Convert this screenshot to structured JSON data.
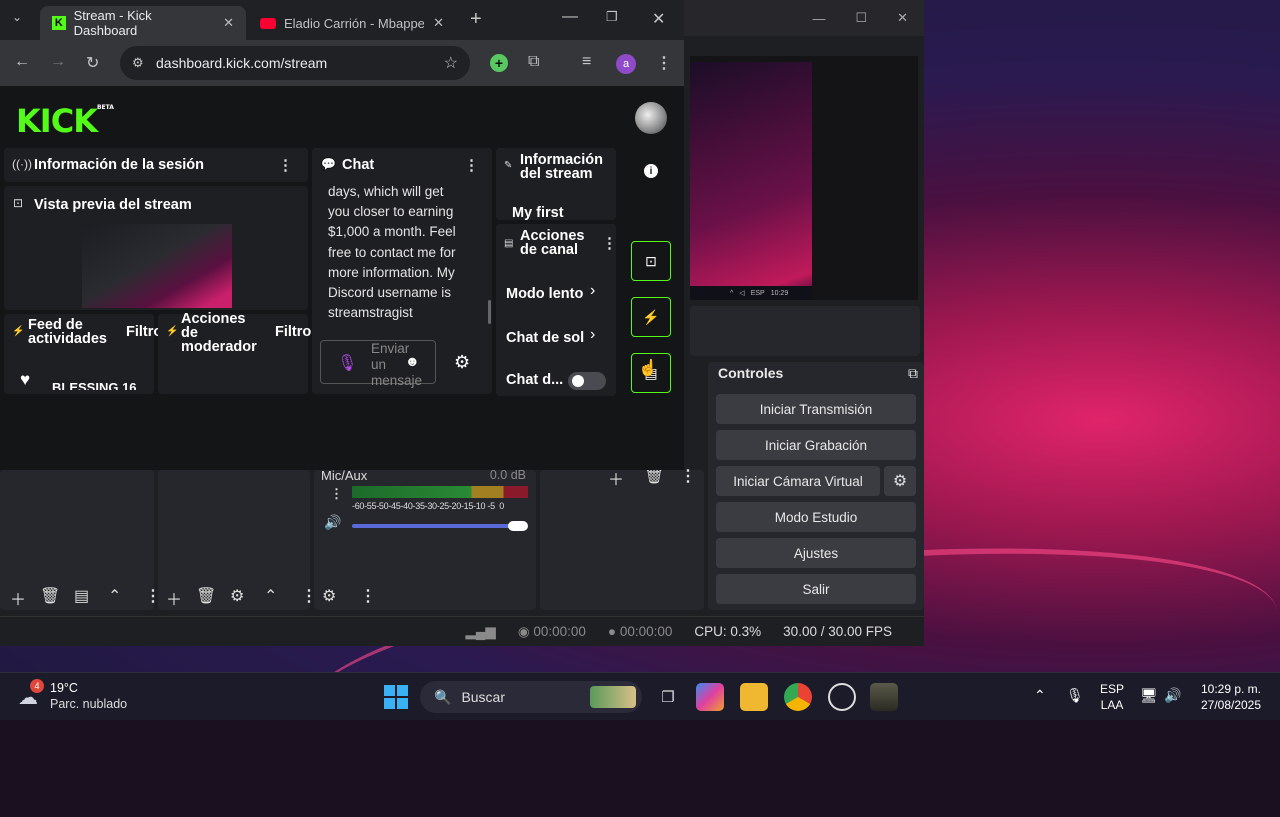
{
  "browser": {
    "tabs": [
      {
        "title": "Stream - Kick Dashboard",
        "active": true
      },
      {
        "title": "Eladio Carrión - Mbappe (",
        "active": false
      }
    ],
    "url": "dashboard.kick.com/stream",
    "profile_initial": "a"
  },
  "kick": {
    "logo": "KICK",
    "logo_badge": "BETA",
    "session_info": "Información de la sesión",
    "stream_preview": "Vista previa del stream",
    "activity_feed": "Feed de actividades",
    "activity_filter": "Filtro",
    "activity_item": "BLESSING 16",
    "mod_actions": "Acciones de moderador",
    "mod_filter": "Filtro",
    "chat_title": "Chat",
    "chat_lines": [
      "days, which will get",
      "you closer to earning",
      "$1,000 a month. Feel",
      "free to contact me for",
      "more information. My",
      "Discord username is",
      "streamstragist"
    ],
    "chat_placeholder": "Enviar un mensaje",
    "stream_info": "Información del stream",
    "stream_info_value": "My first",
    "channel_actions": "Acciones de canal",
    "slow_mode": "Modo lento",
    "sub_chat": "Chat de sol",
    "chat_toggle": "Chat d..."
  },
  "obs": {
    "controls_title": "Controles",
    "buttons": [
      "Iniciar Transmisión",
      "Iniciar Grabación",
      "Iniciar Cámara Virtual",
      "Modo Estudio",
      "Ajustes",
      "Salir"
    ],
    "mixer_channel": "Mic/Aux",
    "mixer_db": "0.0 dB",
    "meter_ticks": "-60-55-50-45-40-35-30-25-20-15-10 -5  0",
    "status": {
      "live_time": "00:00:00",
      "rec_time": "00:00:00",
      "cpu": "CPU: 0.3%",
      "fps": "30.00 / 30.00 FPS"
    }
  },
  "taskbar": {
    "weather_temp": "19°C",
    "weather_desc": "Parc. nublado",
    "weather_badge": "4",
    "search": "Buscar",
    "lang_top": "ESP",
    "lang_bottom": "LAA",
    "time": "10:29 p. m.",
    "date": "27/08/2025"
  }
}
